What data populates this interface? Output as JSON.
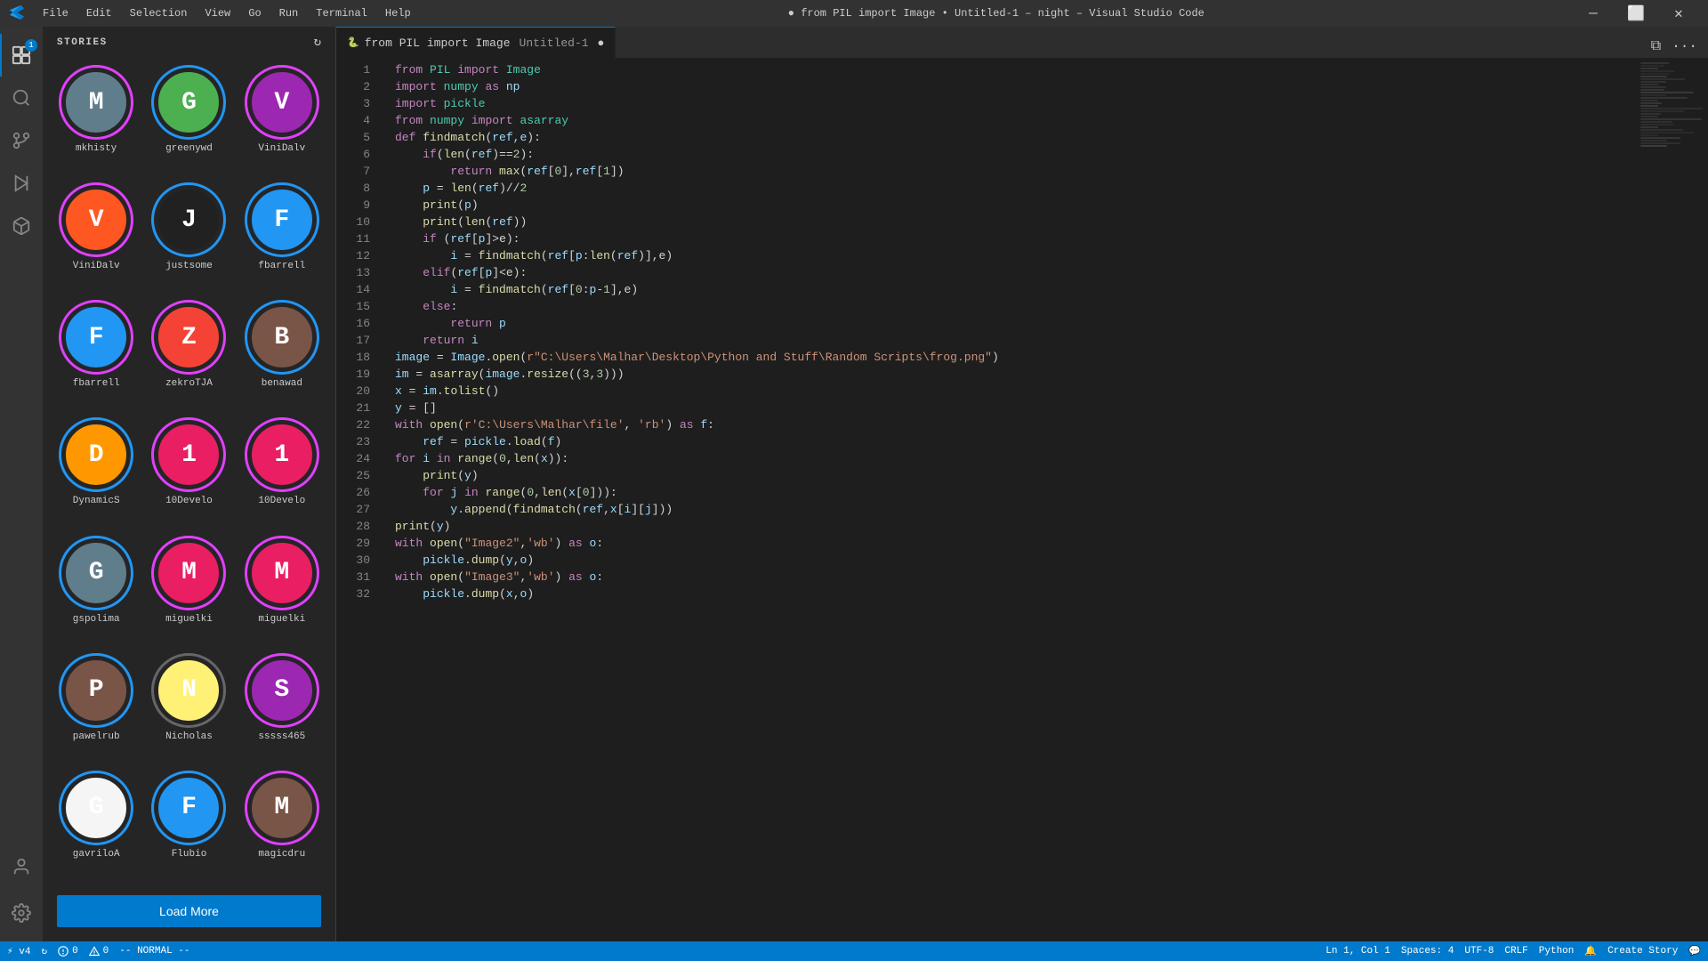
{
  "titlebar": {
    "icon": "VS",
    "menu_items": [
      "File",
      "Edit",
      "Selection",
      "View",
      "Go",
      "Run",
      "Terminal",
      "Help"
    ],
    "title": "● from PIL import Image • Untitled-1 – night – Visual Studio Code",
    "minimize": "—",
    "maximize": "⬜",
    "close": "✕"
  },
  "activity": {
    "icons": [
      {
        "name": "extensions-icon",
        "symbol": "⊞",
        "badge": "1",
        "active": true
      },
      {
        "name": "search-icon",
        "symbol": "🔍",
        "active": false
      },
      {
        "name": "source-control-icon",
        "symbol": "⎇",
        "active": false
      },
      {
        "name": "run-icon",
        "symbol": "▷",
        "active": false
      },
      {
        "name": "extensions-pkg-icon",
        "symbol": "⊟",
        "active": false
      },
      {
        "name": "account-icon",
        "symbol": "👤",
        "bottom": true
      },
      {
        "name": "settings-icon",
        "symbol": "⚙",
        "bottom": true
      }
    ]
  },
  "sidebar": {
    "title": "STORIES",
    "stories": [
      {
        "name": "mkhisty",
        "color1": "#e040fb",
        "color2": "#9c27b0",
        "char": "M",
        "bg": "#607d8b",
        "ring": "pink"
      },
      {
        "name": "greenywd",
        "color1": "#42a5f5",
        "color2": "#1565c0",
        "char": "G",
        "bg": "#4caf50",
        "ring": "blue"
      },
      {
        "name": "ViniDalv",
        "color1": "#e040fb",
        "color2": "#9c27b0",
        "char": "V",
        "bg": "#9c27b0",
        "ring": "pink"
      },
      {
        "name": "ViniDalv",
        "color1": "#e040fb",
        "color2": "#9c27b0",
        "char": "V",
        "bg": "#ff5722",
        "ring": "pink"
      },
      {
        "name": "justsome",
        "color1": "#42a5f5",
        "color2": "#1565c0",
        "char": "J",
        "bg": "#212121",
        "ring": "blue"
      },
      {
        "name": "fbarrell",
        "color1": "#42a5f5",
        "color2": "#1565c0",
        "char": "F",
        "bg": "#2196f3",
        "ring": "blue"
      },
      {
        "name": "fbarrell",
        "color1": "#e040fb",
        "color2": "#9c27b0",
        "char": "F",
        "bg": "#2196f3",
        "ring": "pink"
      },
      {
        "name": "zekroTJA",
        "color1": "#e040fb",
        "color2": "#9c27b0",
        "char": "Z",
        "bg": "#f44336",
        "ring": "pink"
      },
      {
        "name": "benawad",
        "color1": "#42a5f5",
        "color2": "#1565c0",
        "char": "B",
        "bg": "#795548",
        "ring": "blue"
      },
      {
        "name": "DynamicS",
        "color1": "#42a5f5",
        "color2": "#1565c0",
        "char": "D",
        "bg": "#ff9800",
        "ring": "blue"
      },
      {
        "name": "10Develo",
        "color1": "#e040fb",
        "color2": "#9c27b0",
        "char": "1",
        "bg": "#e91e63",
        "ring": "pink"
      },
      {
        "name": "10Develo",
        "color1": "#e040fb",
        "color2": "#9c27b0",
        "char": "1",
        "bg": "#e91e63",
        "ring": "pink"
      },
      {
        "name": "gspolima",
        "color1": "#42a5f5",
        "color2": "#1565c0",
        "char": "G",
        "bg": "#607d8b",
        "ring": "blue"
      },
      {
        "name": "miguelki",
        "color1": "#e040fb",
        "color2": "#9c27b0",
        "char": "M",
        "bg": "#e91e63",
        "ring": "pink"
      },
      {
        "name": "miguelki",
        "color1": "#e040fb",
        "color2": "#9c27b0",
        "char": "M",
        "bg": "#e91e63",
        "ring": "pink"
      },
      {
        "name": "pawelrub",
        "color1": "#42a5f5",
        "color2": "#1565c0",
        "char": "P",
        "bg": "#795548",
        "ring": "blue"
      },
      {
        "name": "Nicholas",
        "color1": "#666",
        "color2": "#444",
        "char": "N",
        "bg": "#fff176",
        "ring": "gray"
      },
      {
        "name": "sssss465",
        "color1": "#e040fb",
        "color2": "#9c27b0",
        "char": "S",
        "bg": "#9c27b0",
        "ring": "pink"
      },
      {
        "name": "gavriloA",
        "color1": "#42a5f5",
        "color2": "#1565c0",
        "char": "G",
        "bg": "#f5f5f5",
        "ring": "blue"
      },
      {
        "name": "Flubio",
        "color1": "#42a5f5",
        "color2": "#1565c0",
        "char": "F",
        "bg": "#2196f3",
        "ring": "blue"
      },
      {
        "name": "magicdru",
        "color1": "#e040fb",
        "color2": "#9c27b0",
        "char": "M",
        "bg": "#795548",
        "ring": "pink"
      }
    ],
    "load_more": "Load More"
  },
  "tab": {
    "file_icon": "🐍",
    "tab_label": "from PIL import Image",
    "untitled": "Untitled-1",
    "modified_dot": true
  },
  "code": {
    "lines": [
      {
        "n": 1,
        "text": "from PIL import Image"
      },
      {
        "n": 2,
        "text": "import numpy as np"
      },
      {
        "n": 3,
        "text": "import pickle"
      },
      {
        "n": 4,
        "text": "from numpy import asarray"
      },
      {
        "n": 5,
        "text": "def findmatch(ref,e):"
      },
      {
        "n": 6,
        "text": "    if(len(ref)==2):"
      },
      {
        "n": 7,
        "text": "        return max(ref[0],ref[1])"
      },
      {
        "n": 8,
        "text": "    p = len(ref)//2"
      },
      {
        "n": 9,
        "text": "    print(p)"
      },
      {
        "n": 10,
        "text": "    print(len(ref))"
      },
      {
        "n": 11,
        "text": "    if (ref[p]>e):"
      },
      {
        "n": 12,
        "text": "        i = findmatch(ref[p:len(ref)],e)"
      },
      {
        "n": 13,
        "text": "    elif(ref[p]<e):"
      },
      {
        "n": 14,
        "text": "        i = findmatch(ref[0:p-1],e)"
      },
      {
        "n": 15,
        "text": "    else:"
      },
      {
        "n": 16,
        "text": "        return p"
      },
      {
        "n": 17,
        "text": "    return i"
      },
      {
        "n": 18,
        "text": "image = Image.open(r\"C:\\Users\\Malhar\\Desktop\\Python and Stuff\\Random Scripts\\frog.png\")"
      },
      {
        "n": 19,
        "text": "im = asarray(image.resize((3,3)))"
      },
      {
        "n": 20,
        "text": "x = im.tolist()"
      },
      {
        "n": 21,
        "text": "y = []"
      },
      {
        "n": 22,
        "text": "with open(r'C:\\Users\\Malhar\\file', 'rb') as f:"
      },
      {
        "n": 23,
        "text": "    ref = pickle.load(f)"
      },
      {
        "n": 24,
        "text": "for i in range(0,len(x)):"
      },
      {
        "n": 25,
        "text": "    print(y)"
      },
      {
        "n": 26,
        "text": "    for j in range(0,len(x[0])):"
      },
      {
        "n": 27,
        "text": "        y.append(findmatch(ref,x[i][j]))"
      },
      {
        "n": 28,
        "text": "print(y)"
      },
      {
        "n": 29,
        "text": "with open(\"Image2\",'wb') as o:"
      },
      {
        "n": 30,
        "text": "    pickle.dump(y,o)"
      },
      {
        "n": 31,
        "text": "with open(\"Image3\",'wb') as o:"
      },
      {
        "n": 32,
        "text": "    pickle.dump(x,o)"
      }
    ]
  },
  "statusbar": {
    "version": "⚡ v4",
    "sync": "↻",
    "errors": "⊗ 0",
    "warnings": "⚠ 0",
    "mode": "-- NORMAL --",
    "position": "Ln 1, Col 1",
    "spaces": "Spaces: 4",
    "encoding": "UTF-8",
    "line_ending": "CRLF",
    "language": "Python",
    "create_story": "Create Story",
    "bell": "🔔",
    "feedback": "💬"
  }
}
